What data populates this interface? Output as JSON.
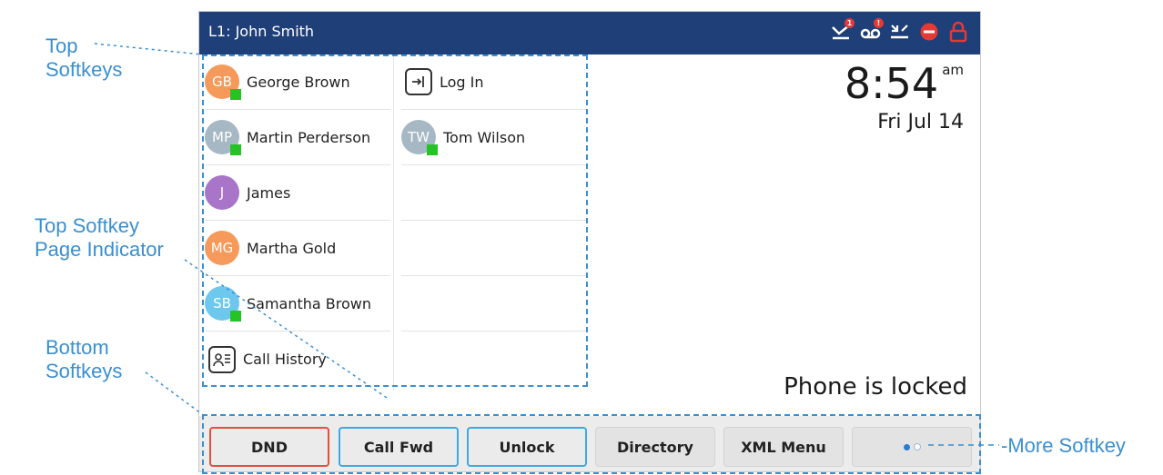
{
  "callouts": {
    "top_softkeys": [
      "Top",
      "Softkeys"
    ],
    "page_indicator": [
      "Top Softkey",
      "Page Indicator"
    ],
    "bottom_softkeys": [
      "Bottom",
      "Softkeys"
    ],
    "more_softkey": "-More Softkey"
  },
  "status_bar": {
    "line_label": "L1: John Smith",
    "icons": [
      {
        "name": "missed-calls-icon",
        "badge": "1",
        "color": "#ffffff"
      },
      {
        "name": "voicemail-icon",
        "badge": "!",
        "color": "#ffffff"
      },
      {
        "name": "call-log-icon",
        "badge": "",
        "color": "#ffffff"
      },
      {
        "name": "do-not-disturb-icon",
        "badge": "",
        "color": "#e53935"
      },
      {
        "name": "lock-icon",
        "badge": "",
        "color": "#e53935"
      }
    ]
  },
  "top_softkeys": {
    "column1": [
      {
        "type": "contact",
        "initials": "GB",
        "label": "George Brown",
        "color": "#f59a5a",
        "presence": true
      },
      {
        "type": "contact",
        "initials": "MP",
        "label": "Martin Perderson",
        "color": "#a6b8c4",
        "presence": true
      },
      {
        "type": "contact",
        "initials": "J",
        "label": "James",
        "color": "#a875c9",
        "presence": false
      },
      {
        "type": "contact",
        "initials": "MG",
        "label": "Martha Gold",
        "color": "#f59a5a",
        "presence": false
      },
      {
        "type": "contact",
        "initials": "SB",
        "label": "Samantha Brown",
        "color": "#6ec8ee",
        "presence": true
      },
      {
        "type": "icon",
        "icon": "call-history-icon",
        "label": "Call History"
      }
    ],
    "column2": [
      {
        "type": "icon",
        "icon": "log-in-icon",
        "label": "Log In"
      },
      {
        "type": "contact",
        "initials": "TW",
        "label": "Tom Wilson",
        "color": "#a6b8c4",
        "presence": true
      }
    ],
    "page_indicator": {
      "pages": 2,
      "current": 1
    }
  },
  "clock": {
    "time": "8:54",
    "ampm": "am",
    "date": "Fri Jul 14"
  },
  "status_message": "Phone is locked",
  "bottom_softkeys": [
    {
      "label": "DND",
      "style": "red"
    },
    {
      "label": "Call Fwd",
      "style": "blue"
    },
    {
      "label": "Unlock",
      "style": "blue"
    },
    {
      "label": "Directory",
      "style": "plain"
    },
    {
      "label": "XML Menu",
      "style": "plain"
    }
  ],
  "more_softkey": {
    "pages": 2,
    "current": 1
  },
  "colors": {
    "status_bar_bg": "#1f3f79",
    "annotation_blue": "#3a8fd0",
    "presence_green": "#25c425",
    "dnd_red": "#e05040",
    "key_blue": "#40a8e0"
  }
}
